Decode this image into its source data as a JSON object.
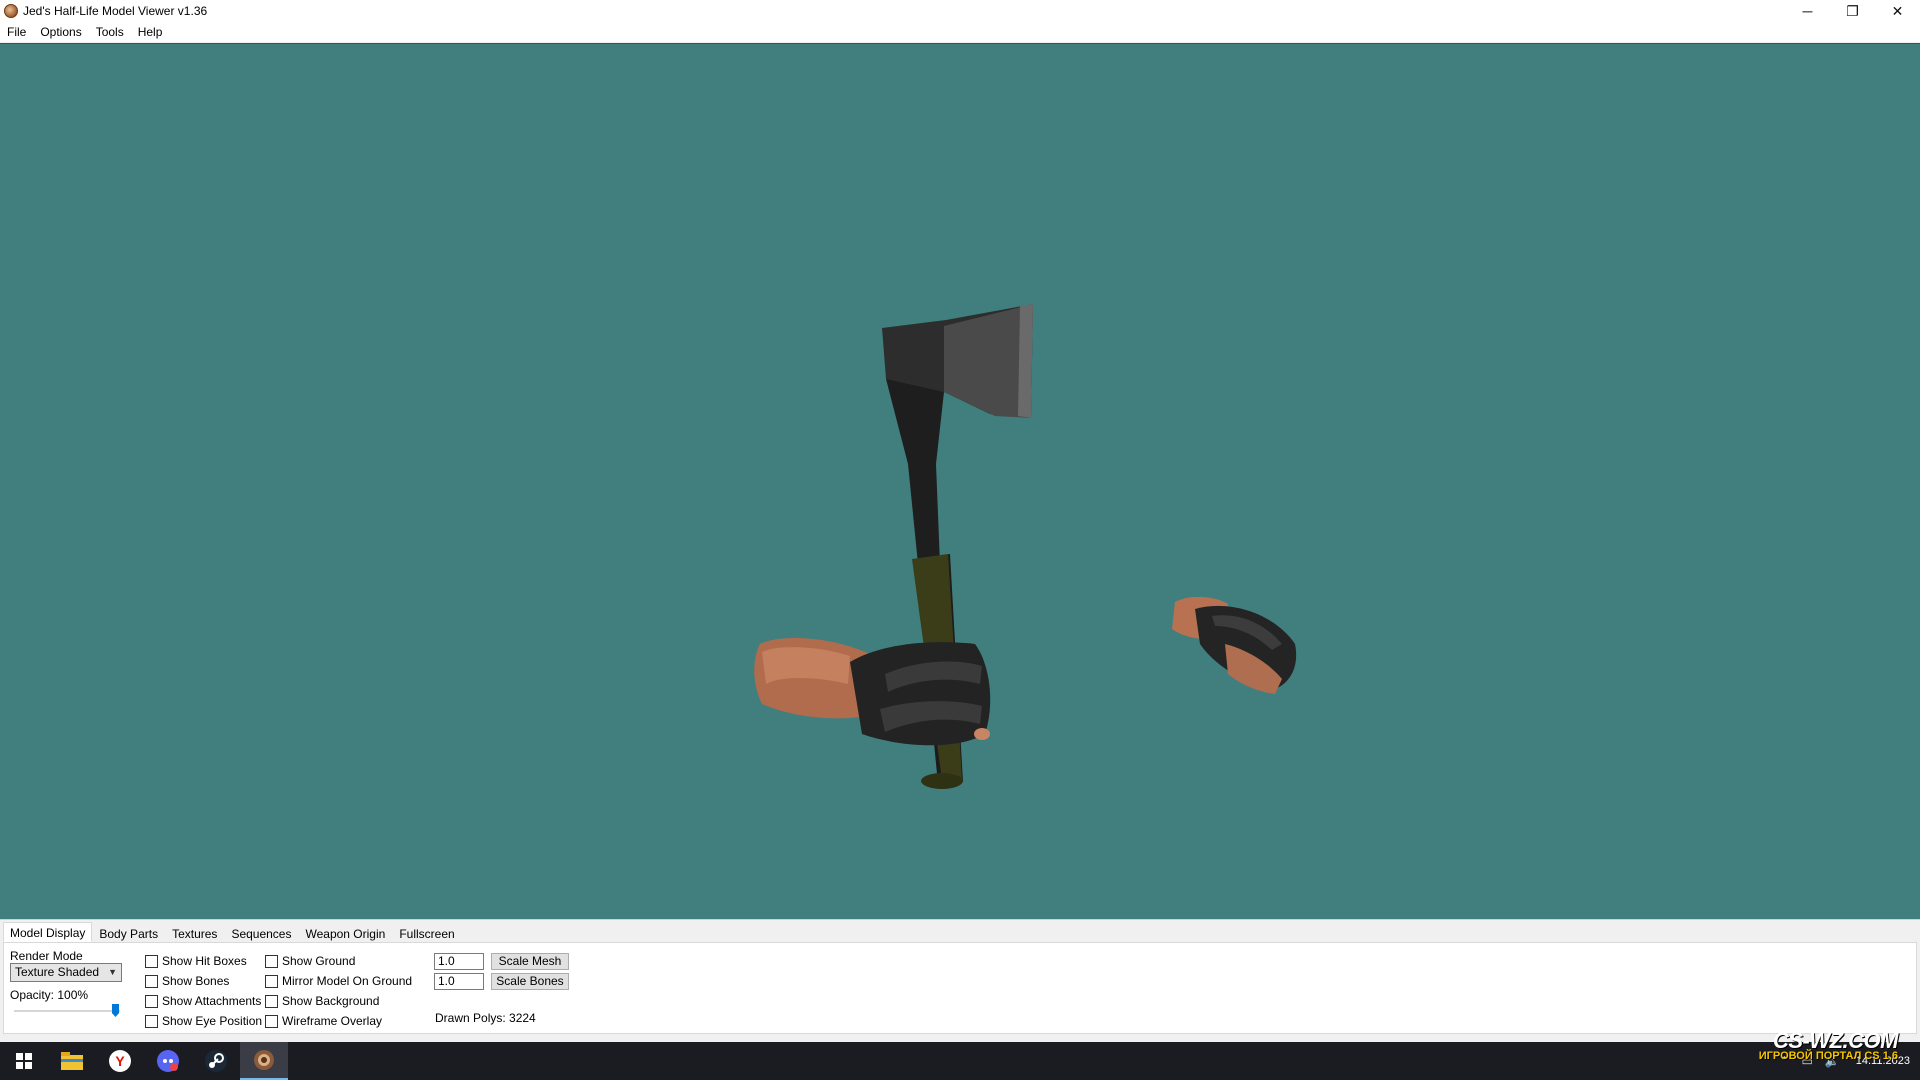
{
  "window": {
    "title": "Jed's Half-Life Model Viewer v1.36",
    "controls": {
      "minimize": "─",
      "restore": "❐",
      "close": "✕"
    }
  },
  "menu": [
    "File",
    "Options",
    "Tools",
    "Help"
  ],
  "viewport": {
    "background_color": "#417f7f"
  },
  "tabs": [
    "Model Display",
    "Body Parts",
    "Textures",
    "Sequences",
    "Weapon Origin",
    "Fullscreen"
  ],
  "model_display": {
    "render_mode_label": "Render Mode",
    "render_mode_value": "Texture Shaded",
    "opacity_label": "Opacity: 100%",
    "opacity_fraction": 1.0,
    "checkboxes_col1": [
      {
        "label": "Show Hit Boxes",
        "checked": false
      },
      {
        "label": "Show Bones",
        "checked": false
      },
      {
        "label": "Show Attachments",
        "checked": false
      },
      {
        "label": "Show Eye Position",
        "checked": false
      }
    ],
    "checkboxes_col2": [
      {
        "label": "Show Ground",
        "checked": false
      },
      {
        "label": "Mirror Model On Ground",
        "checked": false
      },
      {
        "label": "Show Background",
        "checked": false
      },
      {
        "label": "Wireframe Overlay",
        "checked": false
      }
    ],
    "scale_mesh_value": "1.0",
    "scale_mesh_button": "Scale Mesh",
    "scale_bones_value": "1.0",
    "scale_bones_button": "Scale Bones",
    "drawn_polys": "Drawn Polys: 3224"
  },
  "taskbar": {
    "items": [
      "start-icon",
      "file-explorer-icon",
      "yandex-browser-icon",
      "discord-icon",
      "steam-icon",
      "model-viewer-icon"
    ],
    "date": "14.11.2023"
  },
  "watermark": {
    "main": "CS-WZ.COM",
    "sub": "ИГРОВОЙ ПОРТАЛ CS 1.6"
  }
}
